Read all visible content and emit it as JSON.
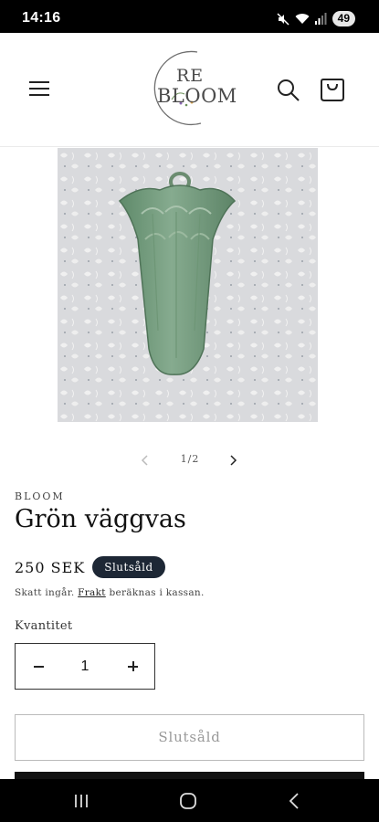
{
  "status_bar": {
    "time": "14:16",
    "battery": "49",
    "icons": [
      "mute-icon",
      "wifi-icon",
      "signal-icon",
      "battery-icon"
    ]
  },
  "header": {
    "logo_line1": "RE",
    "logo_line2": "BLOOM",
    "icons": [
      "menu-icon",
      "search-icon",
      "cart-icon"
    ]
  },
  "slider": {
    "counter": "1/2"
  },
  "product": {
    "vendor": "BLOOM",
    "title": "Grön väggvas",
    "price": "250 SEK",
    "badge": "Slutsåld",
    "tax_before": "Skatt ingår.",
    "tax_link": "Frakt",
    "tax_after": "beräknas i kassan.",
    "quantity_label": "Kvantitet",
    "quantity": "1",
    "soldout_button": "Slutsåld"
  },
  "colors": {
    "badge_bg": "#1d2735",
    "vase_green": "#7a9e82",
    "button_border": "#bbbbbb"
  }
}
